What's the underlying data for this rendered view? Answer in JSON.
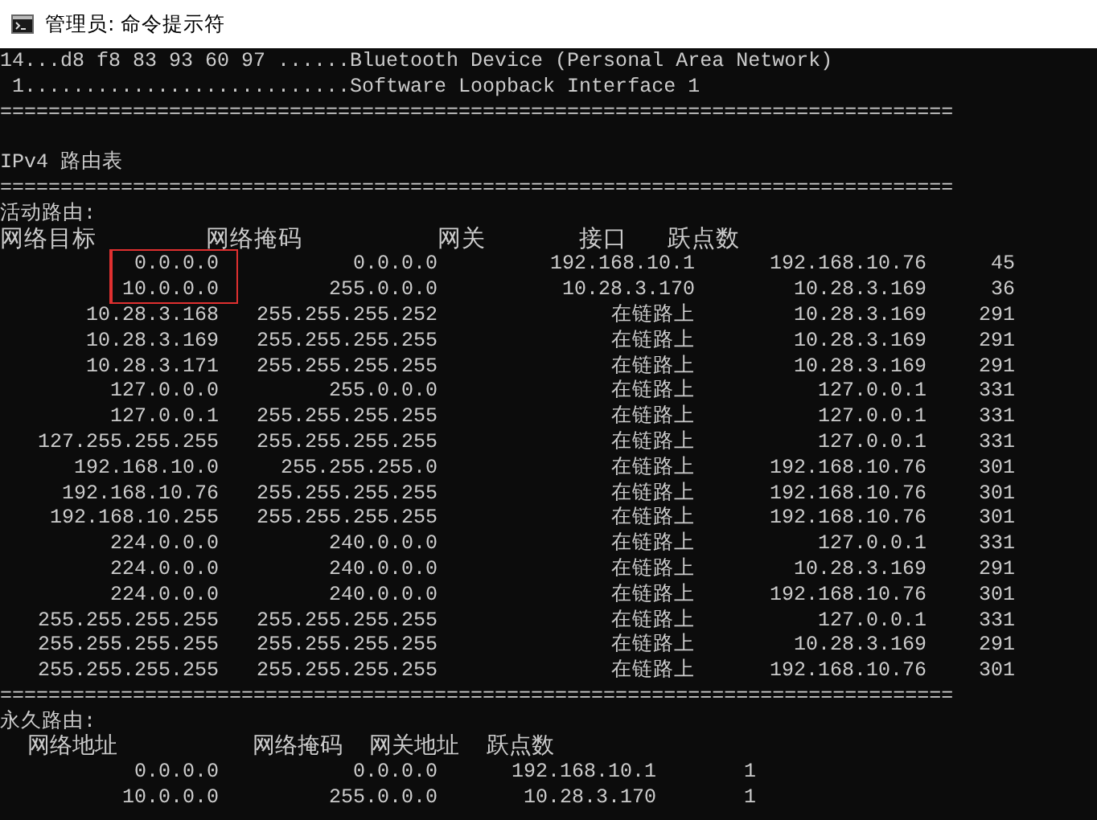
{
  "window": {
    "title": "管理员: 命令提示符"
  },
  "interface_lines": [
    "14...d8 f8 83 93 60 97 ......Bluetooth Device (Personal Area Network)",
    " 1...........................Software Loopback Interface 1"
  ],
  "separator_1": "===============================================================================",
  "ipv4_title": "IPv4 路由表",
  "separator_2": "===============================================================================",
  "active_routes": {
    "title": "活动路由:",
    "columns": [
      "网络目标",
      "网络掩码",
      "网关",
      "接口",
      "跃点数"
    ],
    "highlight": {
      "color": "#e03030"
    },
    "rows": [
      {
        "cells": [
          "0.0.0.0",
          "0.0.0.0",
          "192.168.10.1",
          "192.168.10.76",
          "45"
        ],
        "highlighted": true
      },
      {
        "cells": [
          "10.0.0.0",
          "255.0.0.0",
          "10.28.3.170",
          "10.28.3.169",
          "36"
        ],
        "highlighted": true
      },
      {
        "cells": [
          "10.28.3.168",
          "255.255.255.252",
          "在链路上",
          "10.28.3.169",
          "291"
        ],
        "highlighted": false
      },
      {
        "cells": [
          "10.28.3.169",
          "255.255.255.255",
          "在链路上",
          "10.28.3.169",
          "291"
        ],
        "highlighted": false
      },
      {
        "cells": [
          "10.28.3.171",
          "255.255.255.255",
          "在链路上",
          "10.28.3.169",
          "291"
        ],
        "highlighted": false
      },
      {
        "cells": [
          "127.0.0.0",
          "255.0.0.0",
          "在链路上",
          "127.0.0.1",
          "331"
        ],
        "highlighted": false
      },
      {
        "cells": [
          "127.0.0.1",
          "255.255.255.255",
          "在链路上",
          "127.0.0.1",
          "331"
        ],
        "highlighted": false
      },
      {
        "cells": [
          "127.255.255.255",
          "255.255.255.255",
          "在链路上",
          "127.0.0.1",
          "331"
        ],
        "highlighted": false
      },
      {
        "cells": [
          "192.168.10.0",
          "255.255.255.0",
          "在链路上",
          "192.168.10.76",
          "301"
        ],
        "highlighted": false
      },
      {
        "cells": [
          "192.168.10.76",
          "255.255.255.255",
          "在链路上",
          "192.168.10.76",
          "301"
        ],
        "highlighted": false
      },
      {
        "cells": [
          "192.168.10.255",
          "255.255.255.255",
          "在链路上",
          "192.168.10.76",
          "301"
        ],
        "highlighted": false
      },
      {
        "cells": [
          "224.0.0.0",
          "240.0.0.0",
          "在链路上",
          "127.0.0.1",
          "331"
        ],
        "highlighted": false
      },
      {
        "cells": [
          "224.0.0.0",
          "240.0.0.0",
          "在链路上",
          "10.28.3.169",
          "291"
        ],
        "highlighted": false
      },
      {
        "cells": [
          "224.0.0.0",
          "240.0.0.0",
          "在链路上",
          "192.168.10.76",
          "301"
        ],
        "highlighted": false
      },
      {
        "cells": [
          "255.255.255.255",
          "255.255.255.255",
          "在链路上",
          "127.0.0.1",
          "331"
        ],
        "highlighted": false
      },
      {
        "cells": [
          "255.255.255.255",
          "255.255.255.255",
          "在链路上",
          "10.28.3.169",
          "291"
        ],
        "highlighted": false
      },
      {
        "cells": [
          "255.255.255.255",
          "255.255.255.255",
          "在链路上",
          "192.168.10.76",
          "301"
        ],
        "highlighted": false
      }
    ]
  },
  "separator_3": "===============================================================================",
  "persistent_routes": {
    "title": "永久路由:",
    "header": "  网络地址          网络掩码  网关地址  跃点数",
    "rows": [
      {
        "cells": [
          "0.0.0.0",
          "0.0.0.0",
          "192.168.10.1",
          "1"
        ]
      },
      {
        "cells": [
          "10.0.0.0",
          "255.0.0.0",
          "10.28.3.170",
          "1"
        ]
      }
    ]
  }
}
